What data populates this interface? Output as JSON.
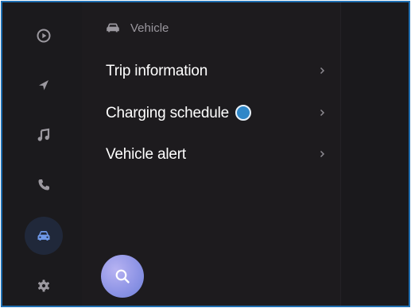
{
  "header": {
    "icon": "car-icon",
    "title": "Vehicle"
  },
  "menu": [
    {
      "label": "Trip information",
      "has_dot": false
    },
    {
      "label": "Charging schedule",
      "has_dot": true
    },
    {
      "label": "Vehicle alert",
      "has_dot": false
    }
  ],
  "sidebar": [
    {
      "icon": "play-circle-icon",
      "active": false
    },
    {
      "icon": "navigation-arrow-icon",
      "active": false
    },
    {
      "icon": "music-note-icon",
      "active": false
    },
    {
      "icon": "phone-icon",
      "active": false
    },
    {
      "icon": "car-icon",
      "active": true
    },
    {
      "icon": "gear-icon",
      "active": false
    }
  ],
  "search_button": {
    "icon": "search-icon"
  },
  "colors": {
    "background": "#1d1b1e",
    "text_primary": "#ffffff",
    "text_secondary": "#9a979e",
    "icon_inactive": "#9c99a0",
    "icon_active": "#6e98e8",
    "accent_dot": "#2f87c8",
    "frame_border": "#1f6fb2"
  }
}
